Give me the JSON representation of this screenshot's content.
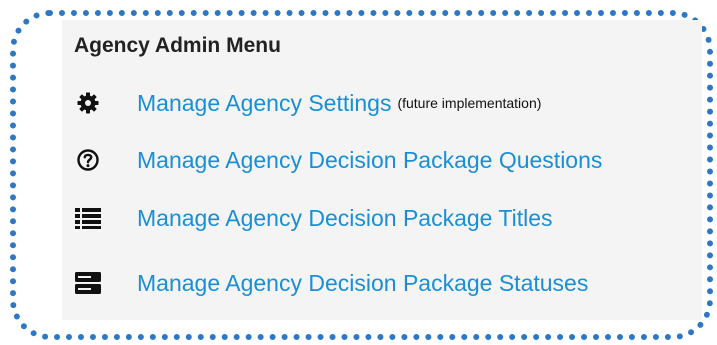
{
  "menu": {
    "title": "Agency Admin Menu",
    "items": [
      {
        "icon": "gear-icon",
        "label": "Manage Agency Settings",
        "note": "(future implementation)"
      },
      {
        "icon": "question-circle-icon",
        "label": "Manage Agency Decision Package Questions"
      },
      {
        "icon": "list-icon",
        "label": "Manage Agency Decision Package Titles"
      },
      {
        "icon": "server-icon",
        "label": "Manage Agency Decision Package Statuses"
      }
    ]
  },
  "colors": {
    "link": "#1a8fd6",
    "frame_border": "#2d78c4",
    "panel_background": "#f4f4f4",
    "icon": "#111111"
  }
}
